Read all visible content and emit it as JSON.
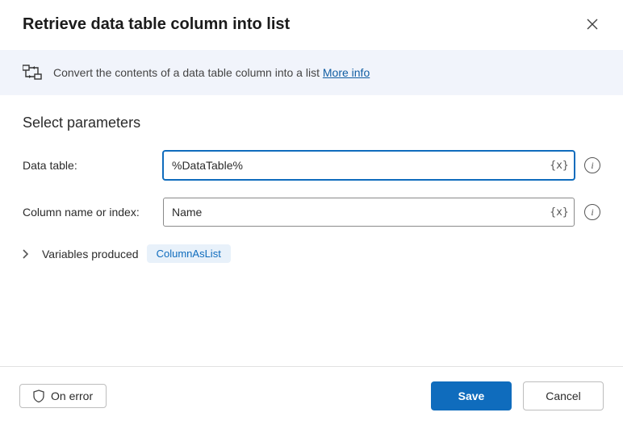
{
  "dialog": {
    "title": "Retrieve data table column into list"
  },
  "infobar": {
    "description": "Convert the contents of a data table column into a list",
    "more_info_label": "More info"
  },
  "params": {
    "section_title": "Select parameters",
    "data_table": {
      "label": "Data table:",
      "value": "%DataTable%",
      "var_btn": "{x}"
    },
    "column_name": {
      "label": "Column name or index:",
      "value": "Name",
      "var_btn": "{x}"
    },
    "variables_produced": {
      "label": "Variables produced",
      "chip": "ColumnAsList"
    }
  },
  "footer": {
    "on_error": "On error",
    "save": "Save",
    "cancel": "Cancel"
  }
}
